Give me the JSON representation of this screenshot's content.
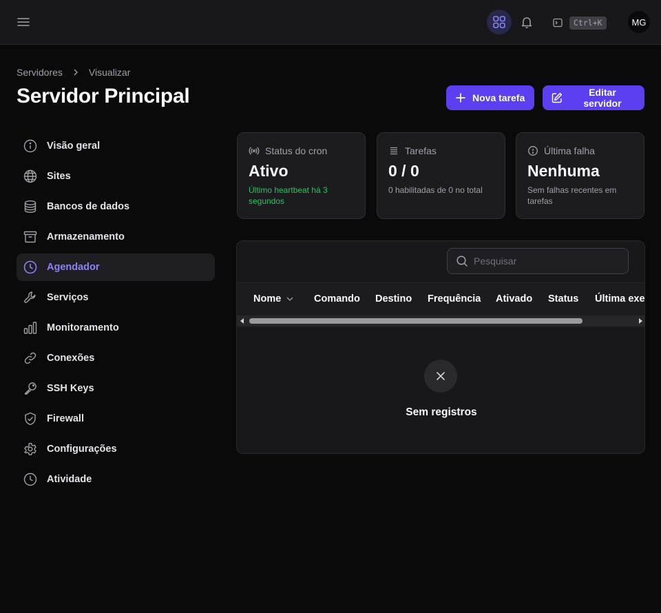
{
  "topbar": {
    "shortcut": "Ctrl+K",
    "avatar_initials": "MG"
  },
  "breadcrumb": {
    "items": [
      "Servidores",
      "Visualizar"
    ]
  },
  "page": {
    "title": "Servidor Principal"
  },
  "actions": {
    "new_task_label": "Nova tarefa",
    "edit_server_label": "Editar servidor"
  },
  "sidebar": {
    "items": [
      {
        "label": "Visão geral",
        "icon": "info-icon"
      },
      {
        "label": "Sites",
        "icon": "globe-icon"
      },
      {
        "label": "Bancos de dados",
        "icon": "database-icon"
      },
      {
        "label": "Armazenamento",
        "icon": "archive-icon"
      },
      {
        "label": "Agendador",
        "icon": "clock-icon",
        "active": true
      },
      {
        "label": "Serviços",
        "icon": "wrench-icon"
      },
      {
        "label": "Monitoramento",
        "icon": "bar-chart-icon"
      },
      {
        "label": "Conexões",
        "icon": "link-icon"
      },
      {
        "label": "SSH Keys",
        "icon": "key-icon"
      },
      {
        "label": "Firewall",
        "icon": "shield-check-icon"
      },
      {
        "label": "Configurações",
        "icon": "gear-icon"
      },
      {
        "label": "Atividade",
        "icon": "clock-icon"
      }
    ]
  },
  "stats": [
    {
      "label": "Status do cron",
      "value": "Ativo",
      "sub": "Último heartbeat há 3 segundos",
      "icon": "signal-icon"
    },
    {
      "label": "Tarefas",
      "value": "0 / 0",
      "sub": "0 habilitadas de 0 no total",
      "icon": "list-icon"
    },
    {
      "label": "Última falha",
      "value": "Nenhuma",
      "sub": "Sem falhas recentes em tarefas",
      "icon": "alert-circle-icon"
    }
  ],
  "table": {
    "search_placeholder": "Pesquisar",
    "columns": [
      "Nome",
      "Comando",
      "Destino",
      "Frequência",
      "Ativado",
      "Status",
      "Última execução"
    ],
    "empty_text": "Sem registros"
  },
  "colors": {
    "accent": "#5b3ff0",
    "active_text": "#8b83f6",
    "success": "#22c55e",
    "background": "#0a0a0b"
  }
}
